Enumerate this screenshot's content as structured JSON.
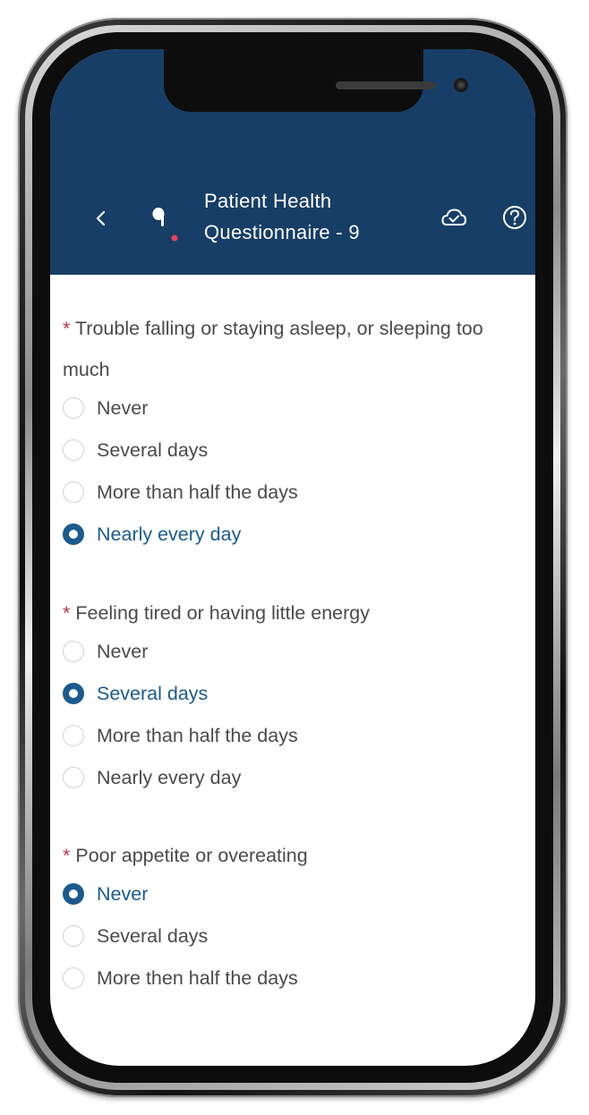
{
  "header": {
    "title_line1": "Patient Health",
    "title_line2": "Questionnaire - 9",
    "icons": [
      "back-icon",
      "microphone-icon",
      "recording-dot",
      "cloud-save-icon",
      "help-icon"
    ],
    "background_color": "#173e66",
    "recording_dot_color": "#e8415a"
  },
  "accent_color": "#1a5a8f",
  "required_marker": "*",
  "questions": [
    {
      "text": "Trouble falling or staying asleep, or sleeping too much",
      "options": [
        "Never",
        "Several days",
        "More than half the days",
        "Nearly every day"
      ],
      "selected": "Nearly every day"
    },
    {
      "text": "Feeling tired or having little energy",
      "options": [
        "Never",
        "Several days",
        "More than half the days",
        "Nearly every day"
      ],
      "selected": "Several days"
    },
    {
      "text": "Poor appetite or overeating",
      "options": [
        "Never",
        "Several days",
        "More then half the days"
      ],
      "selected": "Never"
    }
  ]
}
